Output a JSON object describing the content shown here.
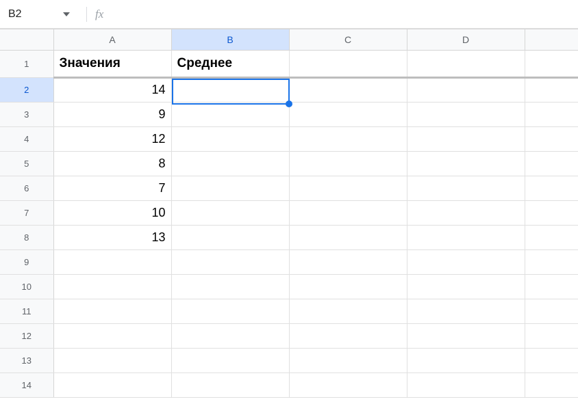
{
  "formula_bar": {
    "cell_ref": "B2",
    "fx_label": "fx",
    "formula_value": ""
  },
  "columns": [
    "A",
    "B",
    "C",
    "D",
    ""
  ],
  "active_column_index": 1,
  "active_row_index": 1,
  "rows": [
    {
      "num": "1",
      "cells": [
        "Значения",
        "Среднее",
        "",
        "",
        ""
      ],
      "header": true
    },
    {
      "num": "2",
      "cells": [
        "14",
        "",
        "",
        "",
        ""
      ]
    },
    {
      "num": "3",
      "cells": [
        "9",
        "",
        "",
        "",
        ""
      ]
    },
    {
      "num": "4",
      "cells": [
        "12",
        "",
        "",
        "",
        ""
      ]
    },
    {
      "num": "5",
      "cells": [
        "8",
        "",
        "",
        "",
        ""
      ]
    },
    {
      "num": "6",
      "cells": [
        "7",
        "",
        "",
        "",
        ""
      ]
    },
    {
      "num": "7",
      "cells": [
        "10",
        "",
        "",
        "",
        ""
      ]
    },
    {
      "num": "8",
      "cells": [
        "13",
        "",
        "",
        "",
        ""
      ]
    },
    {
      "num": "9",
      "cells": [
        "",
        "",
        "",
        "",
        ""
      ]
    },
    {
      "num": "10",
      "cells": [
        "",
        "",
        "",
        "",
        ""
      ]
    },
    {
      "num": "11",
      "cells": [
        "",
        "",
        "",
        "",
        ""
      ]
    },
    {
      "num": "12",
      "cells": [
        "",
        "",
        "",
        "",
        ""
      ]
    },
    {
      "num": "13",
      "cells": [
        "",
        "",
        "",
        "",
        ""
      ]
    },
    {
      "num": "14",
      "cells": [
        "",
        "",
        "",
        "",
        ""
      ]
    }
  ],
  "chart_data": {
    "type": "table",
    "title": "",
    "columns": [
      "Значения",
      "Среднее"
    ],
    "rows": [
      [
        14,
        null
      ],
      [
        9,
        null
      ],
      [
        12,
        null
      ],
      [
        8,
        null
      ],
      [
        7,
        null
      ],
      [
        10,
        null
      ],
      [
        13,
        null
      ]
    ]
  }
}
